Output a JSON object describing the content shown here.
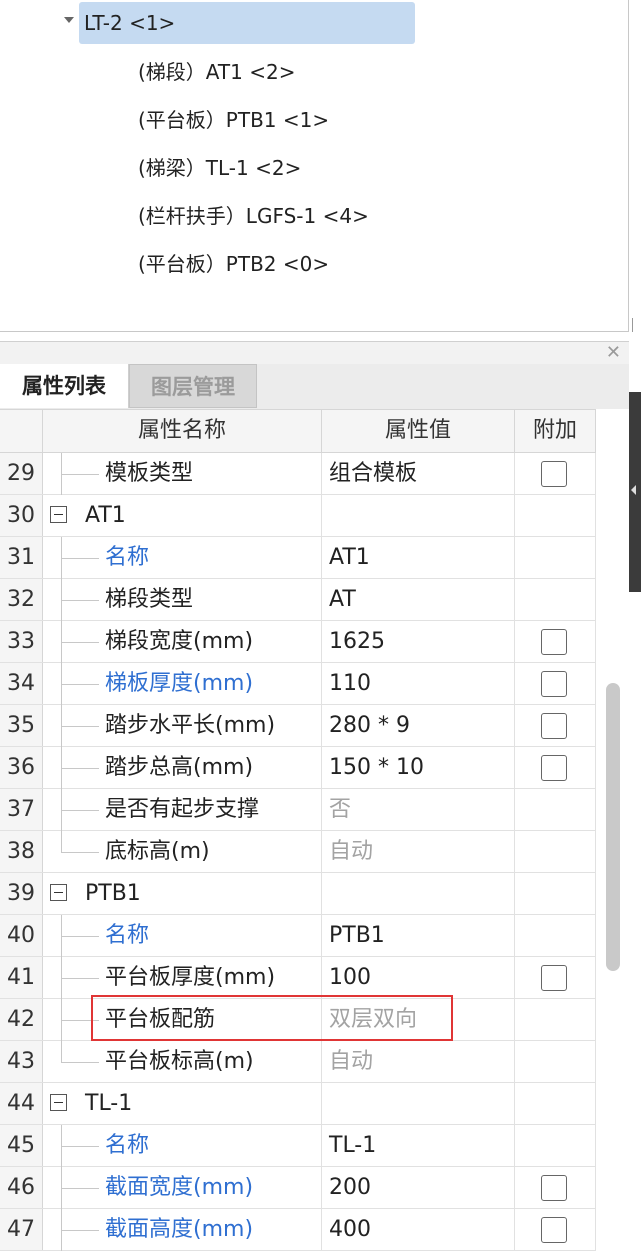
{
  "tree": {
    "root_label": "LT-2 <1>",
    "children": [
      {
        "label": "(梯段）AT1 <2>"
      },
      {
        "label": "(平台板）PTB1 <1>"
      },
      {
        "label": "(梯梁）TL-1 <2>"
      },
      {
        "label": "(栏杆扶手）LGFS-1 <4>"
      },
      {
        "label": "(平台板）PTB2 <0>"
      }
    ]
  },
  "panel": {
    "close_icon": "close-icon",
    "tabs": [
      {
        "label": "属性列表",
        "active": true
      },
      {
        "label": "图层管理",
        "active": false
      }
    ]
  },
  "grid": {
    "headers": {
      "name": "属性名称",
      "value": "属性值",
      "extra": "附加"
    },
    "rows": [
      {
        "num": "29",
        "name": "模板类型",
        "value": "组合模板",
        "checkbox": true,
        "group": false,
        "blue": false,
        "gray": false
      },
      {
        "num": "30",
        "name": "AT1",
        "value": "",
        "checkbox": false,
        "group": true
      },
      {
        "num": "31",
        "name": "名称",
        "value": "AT1",
        "checkbox": false,
        "group": false,
        "blue": true,
        "gray": false
      },
      {
        "num": "32",
        "name": "梯段类型",
        "value": "AT",
        "checkbox": false,
        "group": false,
        "blue": false,
        "gray": false
      },
      {
        "num": "33",
        "name": "梯段宽度(mm)",
        "value": "1625",
        "checkbox": true,
        "group": false,
        "blue": false,
        "gray": false
      },
      {
        "num": "34",
        "name": "梯板厚度(mm)",
        "value": "110",
        "checkbox": true,
        "group": false,
        "blue": true,
        "gray": false
      },
      {
        "num": "35",
        "name": "踏步水平长(mm)",
        "value": "280 * 9",
        "checkbox": true,
        "group": false,
        "blue": false,
        "gray": false
      },
      {
        "num": "36",
        "name": "踏步总高(mm)",
        "value": "150 * 10",
        "checkbox": true,
        "group": false,
        "blue": false,
        "gray": false
      },
      {
        "num": "37",
        "name": "是否有起步支撑",
        "value": "否",
        "checkbox": false,
        "group": false,
        "blue": false,
        "gray": true
      },
      {
        "num": "38",
        "name": "底标高(m)",
        "value": "自动",
        "checkbox": false,
        "group": false,
        "blue": false,
        "gray": true,
        "last_in_group": true
      },
      {
        "num": "39",
        "name": "PTB1",
        "value": "",
        "checkbox": false,
        "group": true
      },
      {
        "num": "40",
        "name": "名称",
        "value": "PTB1",
        "checkbox": false,
        "group": false,
        "blue": true,
        "gray": false
      },
      {
        "num": "41",
        "name": "平台板厚度(mm)",
        "value": "100",
        "checkbox": true,
        "group": false,
        "blue": false,
        "gray": false
      },
      {
        "num": "42",
        "name": "平台板配筋",
        "value": "双层双向",
        "checkbox": false,
        "group": false,
        "blue": false,
        "gray": true
      },
      {
        "num": "43",
        "name": "平台板标高(m)",
        "value": "自动",
        "checkbox": false,
        "group": false,
        "blue": false,
        "gray": true,
        "last_in_group": true
      },
      {
        "num": "44",
        "name": "TL-1",
        "value": "",
        "checkbox": false,
        "group": true
      },
      {
        "num": "45",
        "name": "名称",
        "value": "TL-1",
        "checkbox": false,
        "group": false,
        "blue": true,
        "gray": false
      },
      {
        "num": "46",
        "name": "截面宽度(mm)",
        "value": "200",
        "checkbox": true,
        "group": false,
        "blue": true,
        "gray": false
      },
      {
        "num": "47",
        "name": "截面高度(mm)",
        "value": "400",
        "checkbox": true,
        "group": false,
        "blue": true,
        "gray": false
      }
    ]
  },
  "colors": {
    "blue_text": "#2f6fd1",
    "gray_text": "#a3a3a3",
    "selection": "#c5daf1",
    "highlight": "#e03535"
  }
}
